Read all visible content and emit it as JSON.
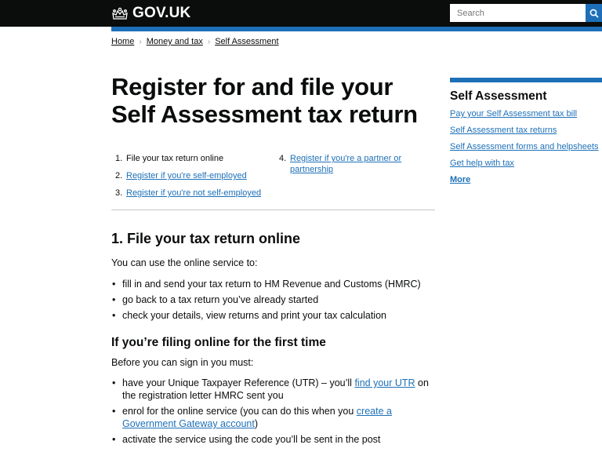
{
  "header": {
    "logo_text": "GOV.UK",
    "search_placeholder": "Search",
    "brand_color": "#1d70b8"
  },
  "breadcrumb": [
    "Home",
    "Money and tax",
    "Self Assessment"
  ],
  "page": {
    "title": "Register for and file your Self Assessment tax return"
  },
  "contents": [
    {
      "num": "1.",
      "label": "File your tax return online",
      "link": false
    },
    {
      "num": "2.",
      "label": "Register if you're self-employed",
      "link": true
    },
    {
      "num": "3.",
      "label": "Register if you're not self-employed",
      "link": true
    },
    {
      "num": "4.",
      "label": "Register if you're a partner or partnership",
      "link": true
    }
  ],
  "section1": {
    "heading": "1. File your tax return online",
    "intro": "You can use the online service to:",
    "bullets": [
      "fill in and send your tax return to HM Revenue and Customs (HMRC)",
      "go back to a tax return you’ve already started",
      "check your details, view returns and print your tax calculation"
    ]
  },
  "section2": {
    "heading": "If you’re filing online for the first time",
    "intro": "Before you can sign in you must:",
    "b1_pre": "have your Unique Taxpayer Reference (UTR) – you’ll ",
    "b1_link": "find your UTR",
    "b1_post": " on the registration letter HMRC sent you",
    "b2_pre": "enrol for the online service (you can do this when you ",
    "b2_link": "create a Government Gateway account",
    "b2_post": ")",
    "b3": "activate the service using the code you’ll be sent in the post"
  },
  "sidebar": {
    "heading": "Self Assessment",
    "links": [
      "Pay your Self Assessment tax bill",
      "Self Assessment tax returns",
      "Self Assessment forms and helpsheets",
      "Get help with tax"
    ],
    "more": "More"
  }
}
